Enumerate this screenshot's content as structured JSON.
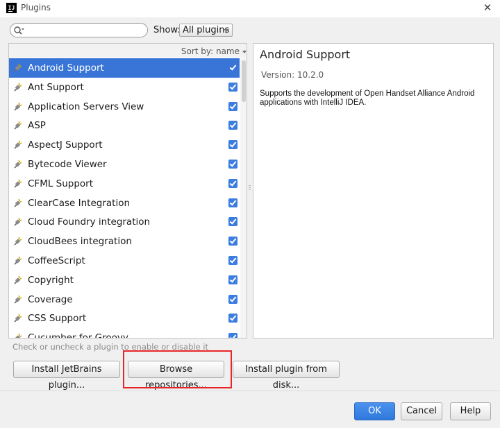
{
  "window": {
    "title": "Plugins",
    "logo_text": "IJ"
  },
  "search": {
    "value": "",
    "placeholder": ""
  },
  "filter": {
    "label": "Show:",
    "selected": "All plugins"
  },
  "list": {
    "sort_label": "Sort by: name",
    "plugins": [
      {
        "name": "Android Support",
        "checked": true,
        "selected": true
      },
      {
        "name": "Ant Support",
        "checked": true
      },
      {
        "name": "Application Servers View",
        "checked": true
      },
      {
        "name": "ASP",
        "checked": true
      },
      {
        "name": "AspectJ Support",
        "checked": true
      },
      {
        "name": "Bytecode Viewer",
        "checked": true
      },
      {
        "name": "CFML Support",
        "checked": true
      },
      {
        "name": "ClearCase Integration",
        "checked": true
      },
      {
        "name": "Cloud Foundry integration",
        "checked": true
      },
      {
        "name": "CloudBees integration",
        "checked": true
      },
      {
        "name": "CoffeeScript",
        "checked": true
      },
      {
        "name": "Copyright",
        "checked": true
      },
      {
        "name": "Coverage",
        "checked": true
      },
      {
        "name": "CSS Support",
        "checked": true
      },
      {
        "name": "Cucumber for Groovy",
        "checked": true
      }
    ]
  },
  "details": {
    "title": "Android Support",
    "version": "Version: 10.2.0",
    "description": "Supports the development of Open Handset Alliance Android applications with IntelliJ IDEA."
  },
  "hint": "Check or uncheck a plugin to enable or disable it",
  "buttons": {
    "install_jetbrains": "Install JetBrains plugin...",
    "browse": "Browse repositories...",
    "install_disk": "Install plugin from disk...",
    "ok": "OK",
    "cancel": "Cancel",
    "help": "Help"
  },
  "colors": {
    "selection": "#3875d7",
    "checkbox": "#3b7de0",
    "highlight": "#e8262a",
    "ok_button": "#3a84e6"
  },
  "icons": {
    "plugin": "plugin-plug-icon",
    "search": "search-icon",
    "close": "close-icon"
  }
}
